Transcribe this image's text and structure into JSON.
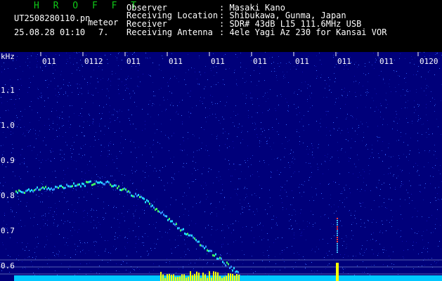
{
  "header": {
    "brand": "H R O F F T",
    "filename": "UT2508280110.pn",
    "filetype": "meteor",
    "date_time": "25.08.28 01:10",
    "minute": "7.",
    "rows": [
      {
        "label": "Observer",
        "value": ": Masaki Kano"
      },
      {
        "label": "Receiving Location",
        "value": ": Shibukawa, Gunma, Japan"
      },
      {
        "label": "Receiver",
        "value": ": SDR# 43dB L15 111.6MHz USB"
      },
      {
        "label": "Receiving Antenna",
        "value": ": 4ele Yagi Az 230 for Kansai VOR"
      }
    ]
  },
  "plot": {
    "y_unit": "kHz",
    "y_ticks": [
      "1.1",
      "1.0",
      "0.9",
      "0.8",
      "0.7",
      "0.6"
    ],
    "x_ticks": [
      "011",
      "0112",
      "011",
      "011",
      "011",
      "011",
      "011",
      "011",
      "011",
      "0120"
    ]
  },
  "colors": {
    "brand": "#10c818",
    "background": "#00007a",
    "baseline": "#00c8ff",
    "hot": "#ffff00"
  }
}
